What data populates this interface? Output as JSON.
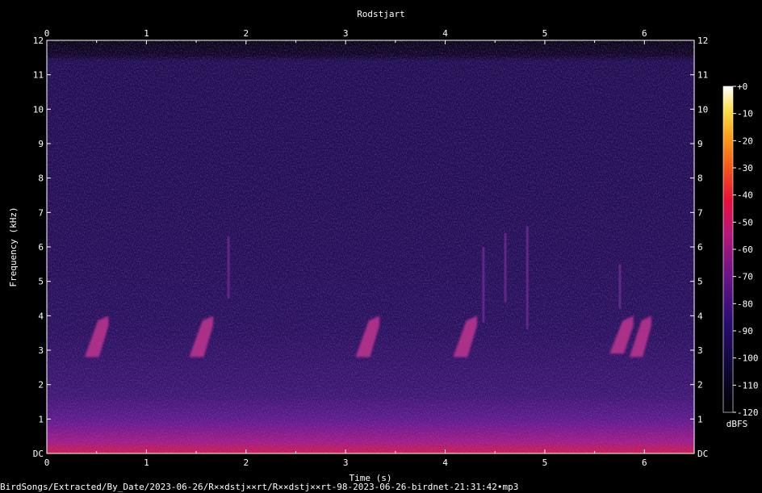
{
  "chart_data": {
    "type": "heatmap",
    "title": "Rodstjart",
    "xlabel": "Time (s)",
    "ylabel": "Frequency (kHz)",
    "xlim": [
      0,
      6.5
    ],
    "ylim": [
      0,
      12
    ],
    "x_ticks": [
      "0",
      "1",
      "2",
      "3",
      "4",
      "5",
      "6"
    ],
    "y_ticks": [
      "DC",
      "1",
      "2",
      "3",
      "4",
      "5",
      "6",
      "7",
      "8",
      "9",
      "10",
      "11",
      "12"
    ],
    "colorbar": {
      "label": "dBFS",
      "range": [
        -120,
        0
      ],
      "ticks": [
        "+0",
        "-10",
        "-20",
        "-30",
        "-40",
        "-50",
        "-60",
        "-70",
        "-80",
        "-90",
        "-100",
        "-110",
        "-120"
      ]
    },
    "calls": [
      {
        "start_s": 0.38,
        "end_s": 0.62,
        "low_khz": 2.8,
        "high_khz": 4.0
      },
      {
        "start_s": 1.43,
        "end_s": 1.67,
        "low_khz": 2.8,
        "high_khz": 4.0
      },
      {
        "start_s": 3.1,
        "end_s": 3.34,
        "low_khz": 2.8,
        "high_khz": 4.0
      },
      {
        "start_s": 4.08,
        "end_s": 4.32,
        "low_khz": 2.8,
        "high_khz": 4.0
      },
      {
        "start_s": 5.65,
        "end_s": 5.89,
        "low_khz": 2.9,
        "high_khz": 4.0
      },
      {
        "start_s": 5.85,
        "end_s": 6.07,
        "low_khz": 2.8,
        "high_khz": 4.0
      }
    ],
    "clicks": [
      {
        "t_s": 1.82,
        "low_khz": 4.5,
        "high_khz": 6.3
      },
      {
        "t_s": 4.38,
        "low_khz": 3.8,
        "high_khz": 6.0
      },
      {
        "t_s": 4.6,
        "low_khz": 4.4,
        "high_khz": 6.4
      },
      {
        "t_s": 4.82,
        "low_khz": 3.6,
        "high_khz": 6.6
      },
      {
        "t_s": 5.75,
        "low_khz": 4.2,
        "high_khz": 5.5
      }
    ],
    "noise_floor_khz": 1.0,
    "cutoff_khz": 11.5
  },
  "footer": {
    "path": "BirdSongs/Extracted/By_Date/2023-06-26/R××dstj××rt/R××dstj××rt-98-2023-06-26-birdnet-21:31:42•mp3"
  }
}
